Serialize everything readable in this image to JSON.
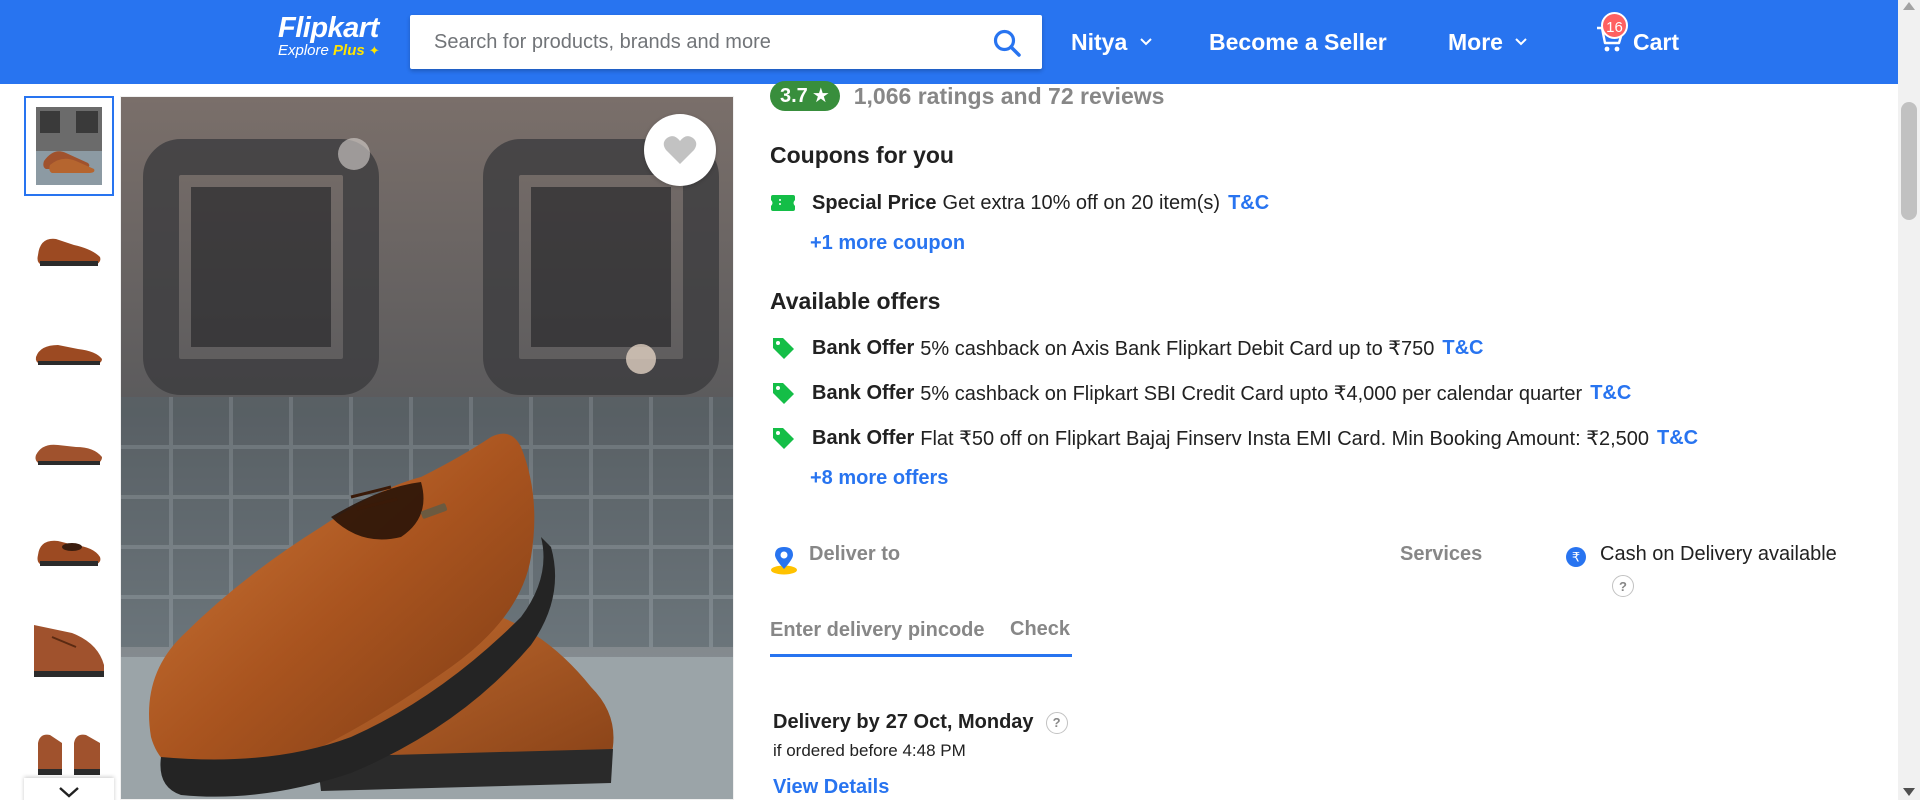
{
  "header": {
    "logo": {
      "word": "Flipkart",
      "explore": "Explore",
      "plus": "Plus"
    },
    "search": {
      "placeholder": "Search for products, brands and more"
    },
    "user_label": "Nitya",
    "seller_label": "Become a Seller",
    "more_label": "More",
    "cart": {
      "label": "Cart",
      "count": "16"
    },
    "colors": {
      "brand_blue": "#2874f0",
      "accent_yellow": "#ffe500"
    }
  },
  "gallery": {
    "thumbnails": [
      {
        "label": "product-view-1"
      },
      {
        "label": "product-view-2"
      },
      {
        "label": "product-view-3"
      },
      {
        "label": "product-view-4"
      },
      {
        "label": "product-view-5"
      },
      {
        "label": "product-view-6"
      },
      {
        "label": "product-view-7"
      }
    ],
    "active_index": 0
  },
  "product": {
    "rating": {
      "value": "3.7",
      "summary": "1,066 ratings and 72 reviews",
      "color": "#388e3c"
    },
    "coupons": {
      "title": "Coupons for you",
      "items": [
        {
          "type": "Special Price",
          "text": "Get extra 10% off on 20 item(s)",
          "tc": "T&C"
        }
      ],
      "more": "+1 more coupon"
    },
    "offers": {
      "title": "Available offers",
      "items": [
        {
          "type": "Bank Offer",
          "text": "5% cashback on Axis Bank Flipkart Debit Card up to ₹750",
          "tc": "T&C"
        },
        {
          "type": "Bank Offer",
          "text": "5% cashback on Flipkart SBI Credit Card upto ₹4,000 per calendar quarter",
          "tc": "T&C"
        },
        {
          "type": "Bank Offer",
          "text": "Flat ₹50 off on Flipkart Bajaj Finserv Insta EMI Card. Min Booking Amount: ₹2,500",
          "tc": "T&C"
        }
      ],
      "more": "+8 more offers"
    },
    "delivery": {
      "deliver_to": "Deliver to",
      "pincode_placeholder": "Enter delivery pincode",
      "check": "Check",
      "by_label": "Delivery by",
      "date": "27 Oct, Monday",
      "cutoff": "if ordered before 4:48 PM",
      "view_details": "View Details"
    },
    "services": {
      "label": "Services",
      "items": [
        {
          "text": "Cash on Delivery available"
        }
      ]
    }
  }
}
